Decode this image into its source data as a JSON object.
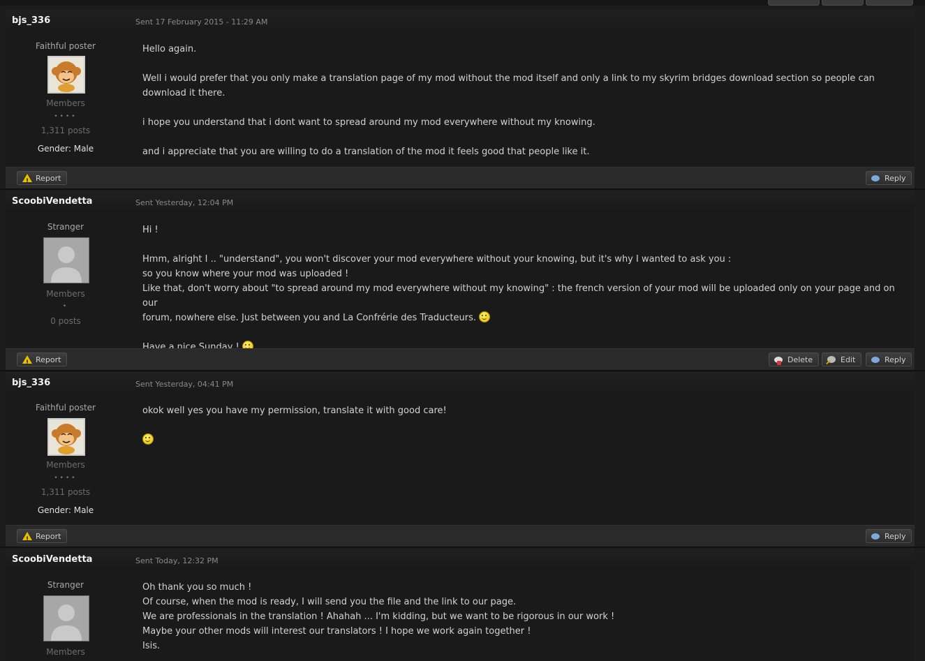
{
  "buttons": {
    "report": "Report",
    "reply": "Reply",
    "delete": "Delete",
    "edit": "Edit"
  },
  "posts": [
    {
      "author": "bjs_336",
      "sent": "Sent 17 February 2015 - 11:29 AM",
      "rank": "Faithful poster",
      "group": "Members",
      "pips": "••••",
      "posts": "1,311 posts",
      "gender_label": "Gender:",
      "gender_value": "Male",
      "paragraphs": [
        "Hello again.",
        "Well i would prefer that you only make a translation page of my mod without the mod itself and only a link to my skyrim bridges download section so people can download it there.",
        "i hope you understand that i dont want to spread around my mod everywhere without my knowing.",
        "and i appreciate that you are willing to do a translation of the mod it feels good that people like it."
      ]
    },
    {
      "author": "ScoobiVendetta",
      "sent": "Sent Yesterday, 12:04 PM",
      "rank": "Stranger",
      "group": "Members",
      "pips": "•",
      "posts": "0 posts",
      "lines": [
        "Hi !",
        "Hmm, alright I .. \"understand\", you won't discover your mod everywhere without your knowing, but it's why I wanted to ask you :",
        "so you know where your mod was uploaded !",
        "Like that, don't worry about \"to spread around my mod everywhere without my knowing\" : the french version of your mod will be uploaded only on your page and on our",
        "forum, nowhere else. Just between you and La Confrérie des Traducteurs.",
        "Have a nice Sunday !"
      ]
    },
    {
      "author": "bjs_336",
      "sent": "Sent Yesterday, 04:41 PM",
      "rank": "Faithful poster",
      "group": "Members",
      "pips": "••••",
      "posts": "1,311 posts",
      "gender_label": "Gender:",
      "gender_value": "Male",
      "paragraphs": [
        "okok well yes you have my permission, translate it with good care!"
      ]
    },
    {
      "author": "ScoobiVendetta",
      "sent": "Sent Today, 12:32 PM",
      "rank": "Stranger",
      "group": "Members",
      "lines": [
        "Oh thank you so much !",
        "Of course, when the mod is ready, I will send you the file and the link to our page.",
        "We are professionals in the translation ! Ahahah ... I'm kidding, but we want to be rigorous in our work !",
        "Maybe your other mods will interest our translators ! I hope we work again together !",
        "Isis."
      ]
    }
  ]
}
